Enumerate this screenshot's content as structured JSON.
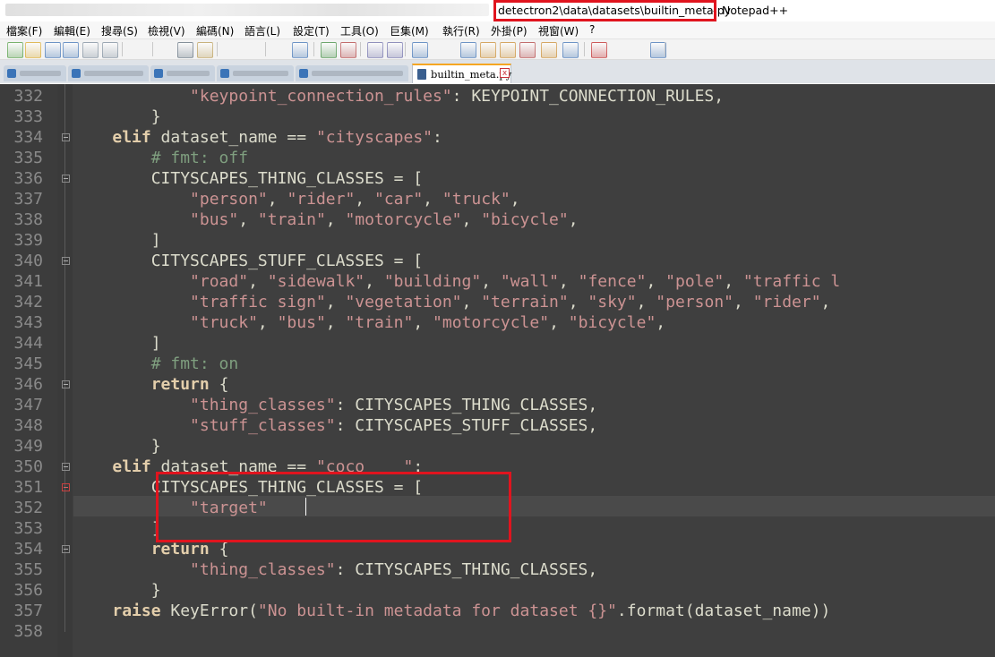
{
  "window": {
    "title_path": "detectron2\\data\\datasets\\builtin_meta.py",
    "title_sep": "-",
    "app_name": "Notepad++"
  },
  "menu": [
    "檔案(F)",
    "編輯(E)",
    "搜尋(S)",
    "檢視(V)",
    "編碼(N)",
    "語言(L)",
    "設定(T)",
    "工具(O)",
    "巨集(M)",
    "執行(R)",
    "外掛(P)",
    "視窗(W)",
    "?"
  ],
  "toolbar_icons": [
    "new-file-icon",
    "open-file-icon",
    "save-icon",
    "save-all-icon",
    "close-icon",
    "close-all-icon",
    "print-icon",
    "cut-icon",
    "copy-icon",
    "paste-icon",
    "undo-icon",
    "redo-icon",
    "find-icon",
    "replace-icon",
    "zoom-in-icon",
    "zoom-out-icon",
    "sync-vertical-icon",
    "sync-horizontal-icon",
    "word-wrap-icon",
    "show-all-chars-icon",
    "indent-guide-icon",
    "udl-icon",
    "doc-map-icon",
    "function-list-icon",
    "folder-workspace-icon",
    "monitoring-icon",
    "record-macro-icon",
    "stop-macro-icon",
    "play-macro-icon",
    "run-macro-multiple-icon",
    "save-macro-icon"
  ],
  "tabs": {
    "active_label": "builtin_meta.py",
    "close_glyph": "x"
  },
  "editor": {
    "lines": [
      {
        "num": "332",
        "segs": [
          {
            "t": "            "
          },
          {
            "t": "\"keypoint_connection_rules\"",
            "c": "str"
          },
          {
            "t": ": KEYPOINT_CONNECTION_RULES,"
          }
        ]
      },
      {
        "num": "333",
        "segs": [
          {
            "t": "        }"
          }
        ]
      },
      {
        "num": "334",
        "segs": [
          {
            "t": "    "
          },
          {
            "t": "elif",
            "c": "kw"
          },
          {
            "t": " dataset_name == "
          },
          {
            "t": "\"cityscapes\"",
            "c": "str"
          },
          {
            "t": ":"
          }
        ]
      },
      {
        "num": "335",
        "segs": [
          {
            "t": "        "
          },
          {
            "t": "# fmt: off",
            "c": "com"
          }
        ]
      },
      {
        "num": "336",
        "segs": [
          {
            "t": "        CITYSCAPES_THING_CLASSES = ["
          }
        ]
      },
      {
        "num": "337",
        "segs": [
          {
            "t": "            "
          },
          {
            "t": "\"person\"",
            "c": "str"
          },
          {
            "t": ", "
          },
          {
            "t": "\"rider\"",
            "c": "str"
          },
          {
            "t": ", "
          },
          {
            "t": "\"car\"",
            "c": "str"
          },
          {
            "t": ", "
          },
          {
            "t": "\"truck\"",
            "c": "str"
          },
          {
            "t": ","
          }
        ]
      },
      {
        "num": "338",
        "segs": [
          {
            "t": "            "
          },
          {
            "t": "\"bus\"",
            "c": "str"
          },
          {
            "t": ", "
          },
          {
            "t": "\"train\"",
            "c": "str"
          },
          {
            "t": ", "
          },
          {
            "t": "\"motorcycle\"",
            "c": "str"
          },
          {
            "t": ", "
          },
          {
            "t": "\"bicycle\"",
            "c": "str"
          },
          {
            "t": ","
          }
        ]
      },
      {
        "num": "339",
        "segs": [
          {
            "t": "        ]"
          }
        ]
      },
      {
        "num": "340",
        "segs": [
          {
            "t": "        CITYSCAPES_STUFF_CLASSES = ["
          }
        ]
      },
      {
        "num": "341",
        "segs": [
          {
            "t": "            "
          },
          {
            "t": "\"road\"",
            "c": "str"
          },
          {
            "t": ", "
          },
          {
            "t": "\"sidewalk\"",
            "c": "str"
          },
          {
            "t": ", "
          },
          {
            "t": "\"building\"",
            "c": "str"
          },
          {
            "t": ", "
          },
          {
            "t": "\"wall\"",
            "c": "str"
          },
          {
            "t": ", "
          },
          {
            "t": "\"fence\"",
            "c": "str"
          },
          {
            "t": ", "
          },
          {
            "t": "\"pole\"",
            "c": "str"
          },
          {
            "t": ", "
          },
          {
            "t": "\"traffic l",
            "c": "str"
          }
        ]
      },
      {
        "num": "342",
        "segs": [
          {
            "t": "            "
          },
          {
            "t": "\"traffic sign\"",
            "c": "str"
          },
          {
            "t": ", "
          },
          {
            "t": "\"vegetation\"",
            "c": "str"
          },
          {
            "t": ", "
          },
          {
            "t": "\"terrain\"",
            "c": "str"
          },
          {
            "t": ", "
          },
          {
            "t": "\"sky\"",
            "c": "str"
          },
          {
            "t": ", "
          },
          {
            "t": "\"person\"",
            "c": "str"
          },
          {
            "t": ", "
          },
          {
            "t": "\"rider\"",
            "c": "str"
          },
          {
            "t": ","
          }
        ]
      },
      {
        "num": "343",
        "segs": [
          {
            "t": "            "
          },
          {
            "t": "\"truck\"",
            "c": "str"
          },
          {
            "t": ", "
          },
          {
            "t": "\"bus\"",
            "c": "str"
          },
          {
            "t": ", "
          },
          {
            "t": "\"train\"",
            "c": "str"
          },
          {
            "t": ", "
          },
          {
            "t": "\"motorcycle\"",
            "c": "str"
          },
          {
            "t": ", "
          },
          {
            "t": "\"bicycle\"",
            "c": "str"
          },
          {
            "t": ","
          }
        ]
      },
      {
        "num": "344",
        "segs": [
          {
            "t": "        ]"
          }
        ]
      },
      {
        "num": "345",
        "segs": [
          {
            "t": "        "
          },
          {
            "t": "# fmt: on",
            "c": "com"
          }
        ]
      },
      {
        "num": "346",
        "segs": [
          {
            "t": "        "
          },
          {
            "t": "return",
            "c": "kw"
          },
          {
            "t": " {"
          }
        ]
      },
      {
        "num": "347",
        "segs": [
          {
            "t": "            "
          },
          {
            "t": "\"thing_classes\"",
            "c": "str"
          },
          {
            "t": ": CITYSCAPES_THING_CLASSES,"
          }
        ]
      },
      {
        "num": "348",
        "segs": [
          {
            "t": "            "
          },
          {
            "t": "\"stuff_classes\"",
            "c": "str"
          },
          {
            "t": ": CITYSCAPES_STUFF_CLASSES,"
          }
        ]
      },
      {
        "num": "349",
        "segs": [
          {
            "t": "        }"
          }
        ]
      },
      {
        "num": "350",
        "segs": [
          {
            "t": "    "
          },
          {
            "t": "elif",
            "c": "kw"
          },
          {
            "t": " dataset_name == "
          },
          {
            "t": "\"coco",
            "c": "str"
          },
          {
            "t": "    ",
            "c": "blur"
          },
          {
            "t": "\"",
            "c": "str"
          },
          {
            "t": ":"
          }
        ]
      },
      {
        "num": "351",
        "segs": [
          {
            "t": "        CITYSCAPES_THING_CLASSES = ["
          }
        ]
      },
      {
        "num": "352",
        "segs": [
          {
            "t": "            "
          },
          {
            "t": "\"target\"",
            "c": "str"
          }
        ]
      },
      {
        "num": "353",
        "segs": [
          {
            "t": "        ]"
          }
        ]
      },
      {
        "num": "354",
        "segs": [
          {
            "t": "        "
          },
          {
            "t": "return",
            "c": "kw"
          },
          {
            "t": " {"
          }
        ]
      },
      {
        "num": "355",
        "segs": [
          {
            "t": "            "
          },
          {
            "t": "\"thing_classes\"",
            "c": "str"
          },
          {
            "t": ": CITYSCAPES_THING_CLASSES,"
          }
        ]
      },
      {
        "num": "356",
        "segs": [
          {
            "t": "        }"
          }
        ]
      },
      {
        "num": "357",
        "segs": [
          {
            "t": "    "
          },
          {
            "t": "raise",
            "c": "kw"
          },
          {
            "t": " KeyError("
          },
          {
            "t": "\"No built-in metadata for dataset {}\"",
            "c": "str"
          },
          {
            "t": ".format(dataset_name))"
          }
        ]
      },
      {
        "num": "358",
        "segs": []
      }
    ],
    "fold_markers": [
      "334",
      "336",
      "340",
      "346",
      "350",
      "351",
      "354"
    ],
    "fold_markers_changed": [
      "351"
    ]
  }
}
